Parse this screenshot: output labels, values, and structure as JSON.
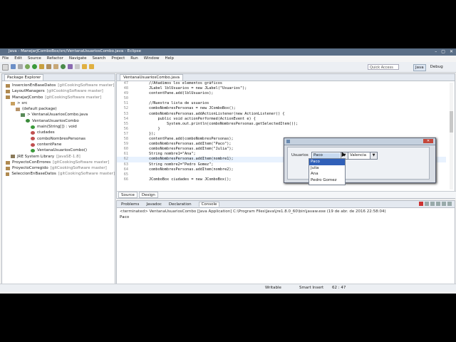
{
  "window": {
    "title": "Java - ManejarJComboBox/src/VentanaUsuariosCombo.java - Eclipse",
    "controls": [
      "–",
      "▢",
      "✕"
    ]
  },
  "menu": [
    "File",
    "Edit",
    "Source",
    "Refactor",
    "Navigate",
    "Search",
    "Project",
    "Run",
    "Window",
    "Help"
  ],
  "toolbar": {
    "quick_access": "Quick Access",
    "perspectives": [
      "Java",
      "Debug"
    ]
  },
  "package_explorer": {
    "tab": "Package Explorer",
    "items": [
      {
        "label": "InsercionEnBaseDatos",
        "decoration": "[gitCookingSoftware master]",
        "icon": "project-icon",
        "indent": 0
      },
      {
        "label": "LayoutManagers",
        "decoration": "[gitCookingSoftware master]",
        "icon": "project-icon",
        "indent": 0
      },
      {
        "label": "ManejarJCombo",
        "decoration": "[gitCookingSoftware master]",
        "icon": "project-icon",
        "indent": 0
      },
      {
        "label": "> src",
        "decoration": "",
        "icon": "source-folder-icon",
        "indent": 1
      },
      {
        "label": "(default package)",
        "decoration": "",
        "icon": "package-icon",
        "indent": 2
      },
      {
        "label": "> VentanaUsuariosCombo.java",
        "decoration": "",
        "icon": "java-file-icon",
        "indent": 3
      },
      {
        "label": "VentanaUsuariosCombo",
        "decoration": "",
        "icon": "class-icon",
        "indent": 4
      },
      {
        "label": "main(String[]) : void",
        "decoration": "",
        "icon": "method-icon",
        "indent": 5
      },
      {
        "label": "ciudades",
        "decoration": "",
        "icon": "field-icon",
        "indent": 5
      },
      {
        "label": "comboNombresPersonas",
        "decoration": "",
        "icon": "field-icon",
        "indent": 5
      },
      {
        "label": "contentPane",
        "decoration": "",
        "icon": "field-icon",
        "indent": 5
      },
      {
        "label": "VentanaUsuariosCombo()",
        "decoration": "",
        "icon": "constructor-icon",
        "indent": 5
      },
      {
        "label": "JRE System Library",
        "decoration": "[JavaSE-1.8]",
        "icon": "library-icon",
        "indent": 1
      },
      {
        "label": "ProyectoConErrores",
        "decoration": "[gitCookingSoftware master]",
        "icon": "project-icon",
        "indent": 0
      },
      {
        "label": "ProyectoCorregido",
        "decoration": "[gitCookingSoftware master]",
        "icon": "project-icon",
        "indent": 0
      },
      {
        "label": "SeleccionEnBaseDatos",
        "decoration": "[gitCookingSoftware master]",
        "icon": "project-icon",
        "indent": 0
      }
    ]
  },
  "editor": {
    "tab": "VentanaUsuariosCombo.java",
    "bottom_tabs": [
      "Source",
      "Design"
    ],
    "highlight_line": 62,
    "lines": [
      {
        "n": "47",
        "t": "        //Añadimos los elementos gráficos"
      },
      {
        "n": "48",
        "t": "        JLabel lblUsuarios = new JLabel(\"Usuarios\");"
      },
      {
        "n": "49",
        "t": "        contentPane.add(lblUsuarios);"
      },
      {
        "n": "50",
        "t": ""
      },
      {
        "n": "51",
        "t": "        //Nuestra lista de usuarios"
      },
      {
        "n": "52",
        "t": "        comboNombresPersonas = new JComboBox();"
      },
      {
        "n": "53",
        "t": "        comboNombresPersonas.addActionListener(new ActionListener() {"
      },
      {
        "n": "54",
        "t": "            public void actionPerformed(ActionEvent e) {"
      },
      {
        "n": "55",
        "t": "                System.out.println(comboNombresPersonas.getSelectedItem());"
      },
      {
        "n": "56",
        "t": "            }"
      },
      {
        "n": "57",
        "t": "        });"
      },
      {
        "n": "58",
        "t": "        contentPane.add(comboNombresPersonas);"
      },
      {
        "n": "59",
        "t": "        comboNombresPersonas.addItem(\"Paco\");"
      },
      {
        "n": "60",
        "t": "        comboNombresPersonas.addItem(\"Julia\");"
      },
      {
        "n": "61",
        "t": "        String nombre1=\"Ana\";"
      },
      {
        "n": "62",
        "t": "        comboNombresPersonas.addItem(nombre1);"
      },
      {
        "n": "63",
        "t": "        String nombre2=\"Pedro Gomez\";"
      },
      {
        "n": "64",
        "t": "        comboNombresPersonas.addItem(nombre2);"
      },
      {
        "n": "65",
        "t": ""
      },
      {
        "n": "66",
        "t": "        JComboBox ciudades = new JComboBox();"
      }
    ]
  },
  "console": {
    "tabs": [
      "Problems",
      "Javadoc",
      "Declaration",
      "Console"
    ],
    "active_tab": "Console",
    "label": "<terminated> VentanaUsuariosCombo [Java Application] C:\\Program Files\\Java\\jre1.8.0_60\\bin\\javaw.exe (19 de abr. de 2016 22:58:04)",
    "output": "Paco"
  },
  "status": {
    "writable": "Writable",
    "insert": "Smart Insert",
    "position": "62 : 47"
  },
  "swing_window": {
    "label": "Usuarios",
    "combo_selected": "Paco",
    "combo_options": [
      "Paco",
      "Julia",
      "Ana",
      "Pedro Gomez"
    ],
    "highlighted_option": "Paco",
    "city_combo": "Valencia"
  },
  "colors": {
    "titlebar": "#5a6e86",
    "selection": "#3060b8",
    "line_highlight": "#e8f2fe"
  }
}
